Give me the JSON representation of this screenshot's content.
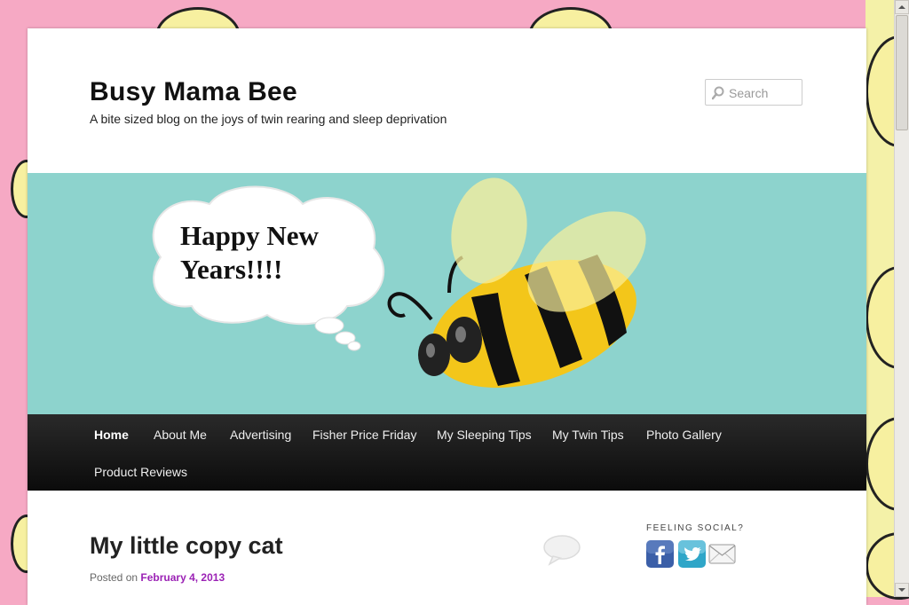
{
  "site": {
    "title": "Busy Mama Bee",
    "description": "A bite sized blog on the joys of twin rearing and sleep deprivation"
  },
  "search": {
    "placeholder": "Search"
  },
  "banner": {
    "bubble_text_line1": "Happy New",
    "bubble_text_line2": "Years!!!!"
  },
  "nav": {
    "items": [
      {
        "label": "Home",
        "active": true
      },
      {
        "label": "About Me"
      },
      {
        "label": "Advertising"
      },
      {
        "label": "Fisher Price Friday"
      },
      {
        "label": "My Sleeping Tips"
      },
      {
        "label": "My Twin Tips"
      },
      {
        "label": "Photo Gallery"
      },
      {
        "label": "Product Reviews"
      }
    ]
  },
  "post": {
    "title": "My little copy cat",
    "posted_prefix": "Posted on",
    "date": "February 4, 2013"
  },
  "sidebar": {
    "widget_title": "FEELING SOCIAL?",
    "icons": [
      "facebook-icon",
      "twitter-icon",
      "email-icon"
    ]
  },
  "colors": {
    "background": "#f6a9c4",
    "banner": "#8dd3cd",
    "nav": "#111111",
    "link": "#9b22b5"
  }
}
